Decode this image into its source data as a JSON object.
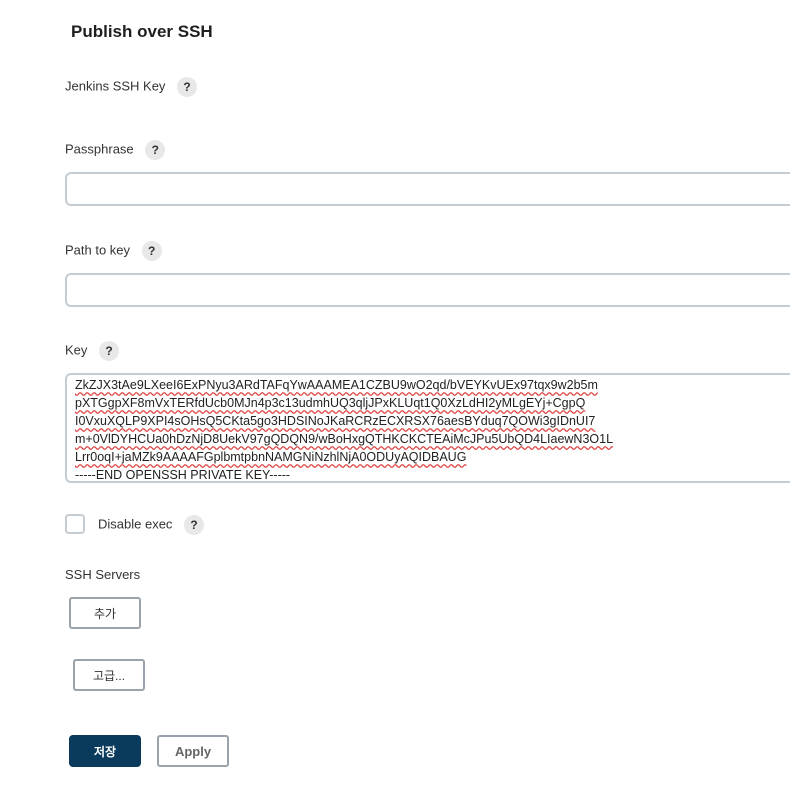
{
  "section": {
    "title": "Publish over SSH"
  },
  "help_label": "?",
  "jenkins_ssh_key": {
    "label": "Jenkins SSH Key"
  },
  "passphrase": {
    "label": "Passphrase",
    "value": ""
  },
  "path_to_key": {
    "label": "Path to key",
    "value": ""
  },
  "key": {
    "label": "Key",
    "lines": [
      "ZkZJX3tAe9LXeeI6ExPNyu3ARdTAFqYwAAAMEA1CZBU9wO2qd/bVEYKvUEx97tqx9w2b5m",
      "pXTGgpXF8mVxTERfdUcb0MJn4p3c13udmhUQ3qljJPxKLUqt1Q0XzLdHI2yMLgEYj+CgpQ",
      "I0VxuXQLP9XPI4sOHsQ5CKta5go3HDSINoJKaRCRzECXRSX76aesBYduq7QOWi3gIDnUI7",
      "m+0VlDYHCUa0hDzNjD8UekV97gQDQN9/wBoHxgQTHKCKCTEAiMcJPu5UbQD4LIaewN3O1L",
      "Lrr0oqI+jaMZk9AAAAFGplbmtpbnNAMGNiNzhlNjA0ODUyAQIDBAUG",
      "-----END OPENSSH PRIVATE KEY-----"
    ]
  },
  "disable_exec": {
    "label": "Disable exec",
    "checked": false
  },
  "ssh_servers": {
    "label": "SSH Servers",
    "add_label": "추가"
  },
  "advanced_label": "고급...",
  "footer": {
    "save_label": "저장",
    "apply_label": "Apply"
  }
}
